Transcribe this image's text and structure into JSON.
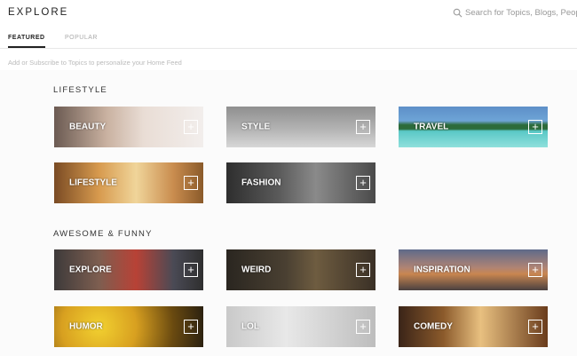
{
  "header": {
    "logo": "EXPLORE",
    "search_placeholder": "Search for Topics, Blogs, People"
  },
  "tabs": [
    {
      "label": "FEATURED",
      "active": true
    },
    {
      "label": "POPULAR",
      "active": false
    }
  ],
  "hint": "Add or Subscribe to Topics to personalize your Home Feed",
  "sections": [
    {
      "title": "LIFESTYLE",
      "topics": [
        "BEAUTY",
        "STYLE",
        "TRAVEL",
        "LIFESTYLE",
        "FASHION"
      ]
    },
    {
      "title": "AWESOME & FUNNY",
      "topics": [
        "EXPLORE",
        "WEIRD",
        "INSPIRATION",
        "HUMOR",
        "LOL",
        "COMEDY"
      ]
    }
  ],
  "add_symbol": "+",
  "icons": {
    "search": "search-icon",
    "add": "plus-icon"
  }
}
